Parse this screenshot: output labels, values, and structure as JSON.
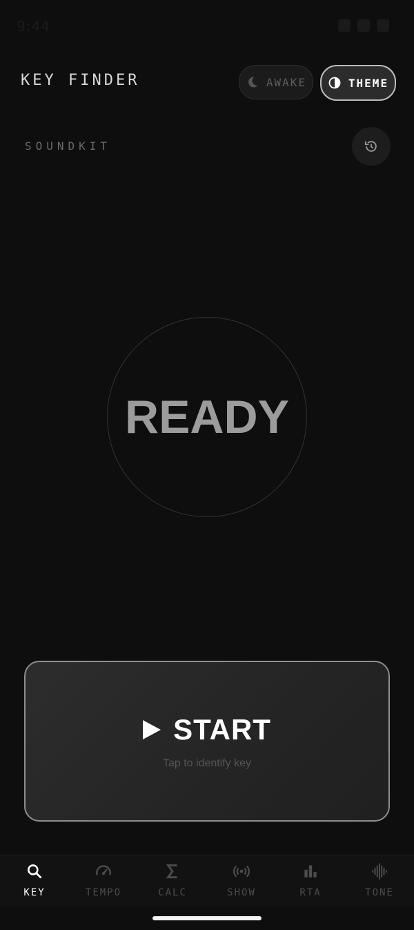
{
  "status_bar": {
    "time": "9:44"
  },
  "header": {
    "title": "KEY FINDER",
    "awake_label": "AWAKE",
    "theme_label": "THEME"
  },
  "brand": "SOUNDKIT",
  "main": {
    "status_text": "READY",
    "start_label": "START",
    "start_hint": "Tap to identify key"
  },
  "nav": {
    "items": [
      {
        "label": "KEY",
        "icon": "search-icon",
        "active": true
      },
      {
        "label": "TEMPO",
        "icon": "speedometer-icon",
        "active": false
      },
      {
        "label": "CALC",
        "icon": "sigma-icon",
        "active": false
      },
      {
        "label": "SHOW",
        "icon": "broadcast-icon",
        "active": false
      },
      {
        "label": "RTA",
        "icon": "bar-chart-icon",
        "active": false
      },
      {
        "label": "TONE",
        "icon": "waveform-icon",
        "active": false
      }
    ]
  },
  "colors": {
    "background": "#0e0e0e",
    "accent": "#ffffff",
    "muted": "#4d4d4d"
  }
}
